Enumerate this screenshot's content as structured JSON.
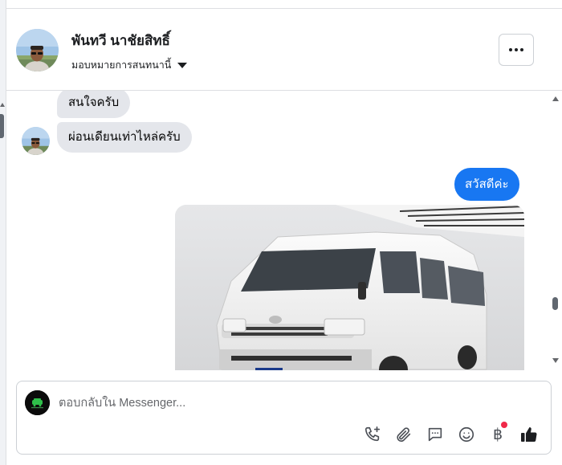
{
  "header": {
    "user_name": "พันทวี นาชัยสิทธิ์",
    "assign_label": "มอบหมายการสนทนานี้",
    "more_icon": "more-horizontal-icon"
  },
  "messages": {
    "incoming": [
      {
        "text": "สนใจครับ"
      },
      {
        "text": "ผ่อนเดียนเท่าไหล่ครับ"
      }
    ],
    "outgoing_text": "สวัสดีค่ะ",
    "photo_subject": "van-photo"
  },
  "reply": {
    "placeholder": "ตอบกลับใน Messenger...",
    "tools": {
      "baht_symbol": "฿",
      "icons": [
        "phone-plus-icon",
        "paperclip-icon",
        "saved-reply-icon",
        "emoji-icon",
        "baht-icon",
        "like-icon"
      ]
    }
  },
  "colors": {
    "accent": "#1877f2",
    "incoming_bubble": "#e4e6eb",
    "notify": "#f02849"
  }
}
